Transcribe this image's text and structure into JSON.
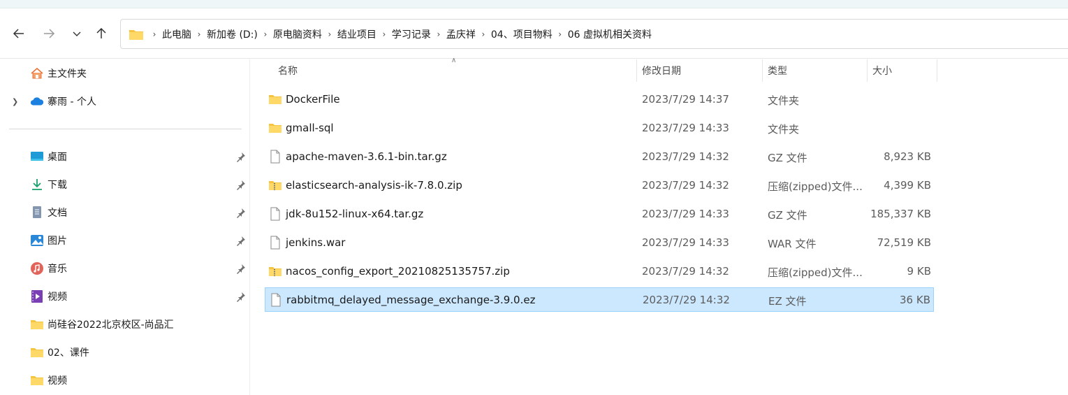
{
  "colors": {
    "folder": "#f5c542",
    "selection_bg": "#cce8ff",
    "selection_border": "#99d1ff",
    "onedrive": "#1b80e0"
  },
  "nav": {
    "back_icon": "arrow-left-icon",
    "forward_icon": "arrow-right-icon",
    "recent_icon": "chevron-down-icon",
    "up_icon": "arrow-up-icon"
  },
  "breadcrumb": [
    "此电脑",
    "新加卷 (D:)",
    "原电脑资料",
    "结业项目",
    "学习记录",
    "孟庆祥",
    "04、项目物料",
    "06 虚拟机相关资料"
  ],
  "sidebar": {
    "home": "主文件夹",
    "onedrive": "寨雨 - 个人",
    "items": [
      {
        "label": "桌面",
        "icon": "desktop-icon",
        "pinned": true
      },
      {
        "label": "下载",
        "icon": "download-icon",
        "pinned": true
      },
      {
        "label": "文档",
        "icon": "document-icon",
        "pinned": true
      },
      {
        "label": "图片",
        "icon": "pictures-icon",
        "pinned": true
      },
      {
        "label": "音乐",
        "icon": "music-icon",
        "pinned": true
      },
      {
        "label": "视频",
        "icon": "video-icon",
        "pinned": true
      },
      {
        "label": "尚硅谷2022北京校区-尚品汇",
        "icon": "folder-icon",
        "pinned": false
      },
      {
        "label": "02、课件",
        "icon": "folder-icon",
        "pinned": false
      },
      {
        "label": "视频",
        "icon": "folder-icon",
        "pinned": false
      }
    ]
  },
  "columns": {
    "name": "名称",
    "date": "修改日期",
    "type": "类型",
    "size": "大小"
  },
  "files": [
    {
      "name": "DockerFile",
      "date": "2023/7/29 14:37",
      "type": "文件夹",
      "size": "",
      "icon": "folder-icon"
    },
    {
      "name": "gmall-sql",
      "date": "2023/7/29 14:33",
      "type": "文件夹",
      "size": "",
      "icon": "folder-icon"
    },
    {
      "name": "apache-maven-3.6.1-bin.tar.gz",
      "date": "2023/7/29 14:32",
      "type": "GZ 文件",
      "size": "8,923 KB",
      "icon": "file-icon"
    },
    {
      "name": "elasticsearch-analysis-ik-7.8.0.zip",
      "date": "2023/7/29 14:32",
      "type": "压缩(zipped)文件...",
      "size": "4,399 KB",
      "icon": "zip-folder-icon"
    },
    {
      "name": "jdk-8u152-linux-x64.tar.gz",
      "date": "2023/7/29 14:33",
      "type": "GZ 文件",
      "size": "185,337 KB",
      "icon": "file-icon"
    },
    {
      "name": "jenkins.war",
      "date": "2023/7/29 14:33",
      "type": "WAR 文件",
      "size": "72,519 KB",
      "icon": "file-icon"
    },
    {
      "name": "nacos_config_export_20210825135757.zip",
      "date": "2023/7/29 14:32",
      "type": "压缩(zipped)文件...",
      "size": "9 KB",
      "icon": "zip-folder-icon"
    },
    {
      "name": "rabbitmq_delayed_message_exchange-3.9.0.ez",
      "date": "2023/7/29 14:32",
      "type": "EZ 文件",
      "size": "36 KB",
      "icon": "file-icon",
      "selected": true
    }
  ]
}
